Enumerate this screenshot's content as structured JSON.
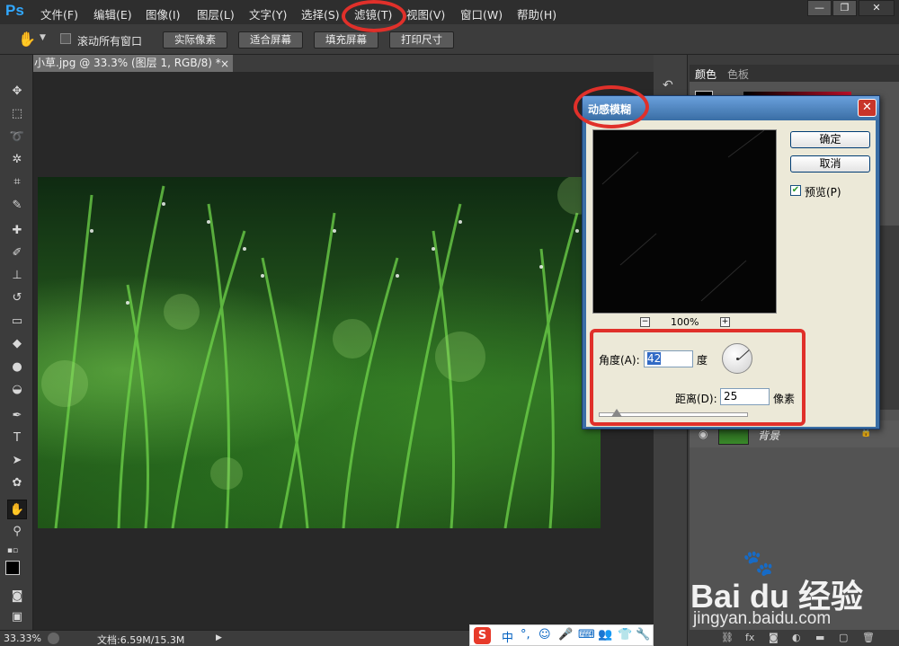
{
  "app": {
    "logo": "Ps"
  },
  "menu": {
    "file": "文件(F)",
    "edit": "编辑(E)",
    "image": "图像(I)",
    "layer": "图层(L)",
    "type": "文字(Y)",
    "select": "选择(S)",
    "filter": "滤镜(T)",
    "view": "视图(V)",
    "window": "窗口(W)",
    "help": "帮助(H)"
  },
  "window_controls": {
    "minimize": "—",
    "restore": "❐",
    "close": "✕"
  },
  "options_bar": {
    "tool_icon": "hand-icon",
    "scroll_all_label": "滚动所有窗口",
    "actual_pixels": "实际像素",
    "fit_screen": "适合屏幕",
    "fill_screen": "填充屏幕",
    "print_size": "打印尺寸"
  },
  "document": {
    "tab_title": "小草.jpg @ 33.3% (图层 1, RGB/8) *",
    "tab_close": "×"
  },
  "toolbar": {
    "tools": [
      "move-icon",
      "marquee-icon",
      "lasso-icon",
      "magic-wand-icon",
      "crop-icon",
      "eyedropper-icon",
      "spot-heal-icon",
      "brush-icon",
      "clone-stamp-icon",
      "history-brush-icon",
      "eraser-icon",
      "paint-bucket-icon",
      "blur-icon",
      "dodge-icon",
      "pen-icon",
      "type-icon",
      "path-select-icon",
      "shape-icon",
      "hand-icon",
      "zoom-icon"
    ],
    "type_tool": "T"
  },
  "status_bar": {
    "zoom": "33.33%",
    "doc_size": "文档:6.59M/15.3M"
  },
  "panels": {
    "color_tab": "颜色",
    "swatches_tab": "色板",
    "layer_name": "背景",
    "footer_icons": [
      "link-icon",
      "fx-icon",
      "mask-icon",
      "adjustment-icon",
      "group-icon",
      "new-layer-icon",
      "trash-icon"
    ]
  },
  "dialog": {
    "title": "动感模糊",
    "close": "✕",
    "ok": "确定",
    "cancel": "取消",
    "preview_checkbox": "预览(P)",
    "zoom_out": "−",
    "zoom_in": "+",
    "zoom_level": "100%",
    "angle_label": "角度(A):",
    "angle_value": "42",
    "angle_unit": "度",
    "distance_label": "距离(D):",
    "distance_value": "25",
    "distance_unit": "像素"
  },
  "annotations": {
    "color": "#e0302a"
  },
  "ime": {
    "logo": "S",
    "lang": "中",
    "items": [
      "°,",
      "☺",
      "🎤",
      "⌨",
      "👥",
      "👕",
      "🔧"
    ]
  },
  "watermark": {
    "brand": "Bai du 经验",
    "url": "jingyan.baidu.com",
    "paw": "🐾"
  }
}
